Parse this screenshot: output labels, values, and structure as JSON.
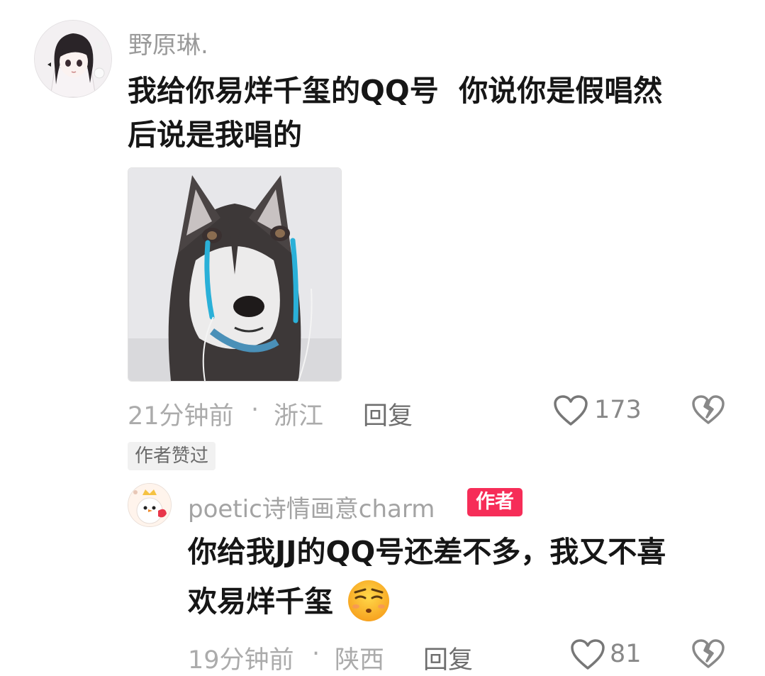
{
  "comment": {
    "username": "野原琳.",
    "text_line1": "我给你易烊千玺的QQ号  你说你是假唱然",
    "text_line2": "后说是我唱的",
    "time": "21分钟前",
    "location": "浙江",
    "reply_label": "回复",
    "like_count": "173",
    "author_liked_tag": "作者赞过"
  },
  "reply": {
    "username": "poetic诗情画意charm",
    "author_badge": "作者",
    "text_line1": "你给我JJ的QQ号还差不多，我又不喜",
    "text_line2": "欢易烊千玺",
    "time": "19分钟前",
    "location": "陕西",
    "reply_label": "回复",
    "like_count": "81"
  },
  "separator": "·",
  "icons": {
    "like": "heart-outline-icon",
    "dislike": "broken-heart-icon",
    "emoji": "unamused-face-emoji"
  },
  "colors": {
    "author_badge": "#f62d58",
    "tear": "#2ab0d8"
  }
}
